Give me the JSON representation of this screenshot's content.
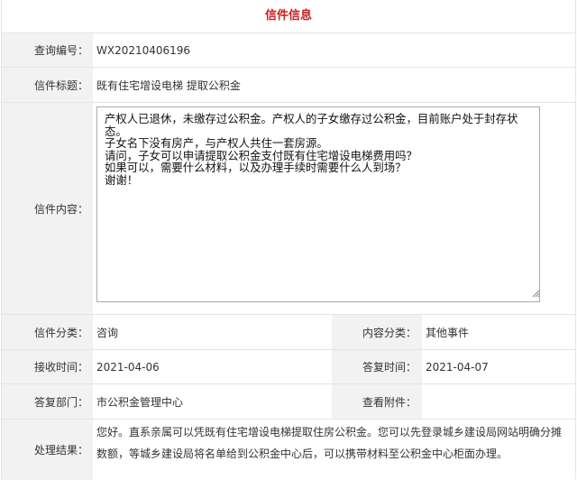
{
  "header": {
    "title": "信件信息"
  },
  "fields": {
    "query_no": {
      "label": "查询编号：",
      "value": "WX20210406196"
    },
    "letter_title": {
      "label": "信件标题：",
      "value": "既有住宅增设电梯 提取公积金"
    },
    "letter_content": {
      "label": "信件内容：",
      "value": "产权人已退休，未缴存过公积金。产权人的子女缴存过公积金，目前账户处于封存状态。\n子女名下没有房产，与产权人共住一套房源。\n请问，子女可以申请提取公积金支付既有住宅增设电梯费用吗？\n如果可以，需要什么材料，以及办理手续时需要什么人到场？\n谢谢！"
    },
    "category": {
      "label": "信件分类：",
      "value": "咨询"
    },
    "content_category": {
      "label": "内容分类：",
      "value": "其他事件"
    },
    "received_time": {
      "label": "接收时间：",
      "value": "2021-04-06"
    },
    "reply_time": {
      "label": "答复时间：",
      "value": "2021-04-07"
    },
    "reply_dept": {
      "label": "答复部门：",
      "value": "市公积金管理中心"
    },
    "attachment": {
      "label": "查看附件：",
      "value": ""
    },
    "result": {
      "label": "处理结果：",
      "value": "您好。直系亲属可以凭既有住宅增设电梯提取住房公积金。您可以先登录城乡建设局网站明确分摊数额，等城乡建设局将名单给到公积金中心后，可以携带材料至公积金中心柜面办理。"
    }
  },
  "icons": {
    "resize_grip": "resize-grip-icon"
  }
}
